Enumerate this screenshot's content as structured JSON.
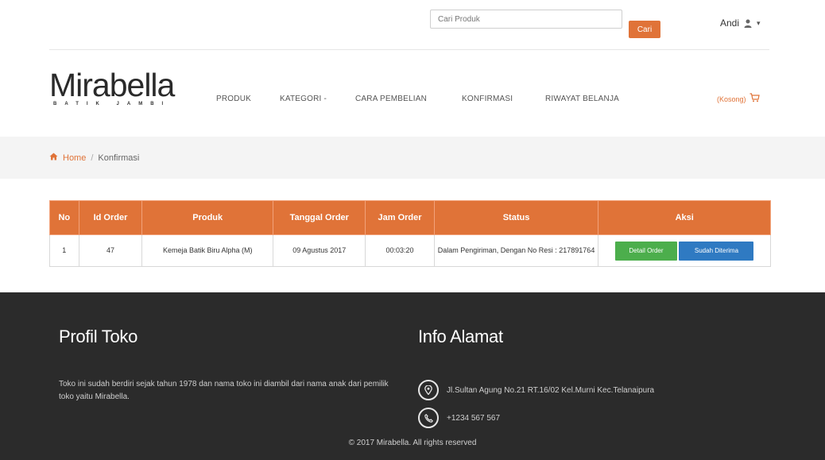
{
  "topbar": {
    "search_placeholder": "Cari Produk",
    "search_button": "Cari",
    "user_name": "Andi",
    "user_icon": "user-icon",
    "caret_icon": "caret-down-icon"
  },
  "header": {
    "logo_main": "Mirabella",
    "logo_sub": "BATIK JAMBI",
    "nav": [
      {
        "label": "PRODUK"
      },
      {
        "label": "KATEGORI -"
      },
      {
        "label": "CARA PEMBELIAN"
      },
      {
        "label": "KONFIRMASI"
      },
      {
        "label": "RIWAYAT BELANJA"
      }
    ],
    "cart_label": "(Kosong)",
    "cart_icon": "cart-icon"
  },
  "breadcrumb": {
    "home": "Home",
    "separator": "/",
    "current": "Konfirmasi"
  },
  "table": {
    "headers": [
      "No",
      "Id Order",
      "Produk",
      "Tanggal Order",
      "Jam Order",
      "Status",
      "Aksi"
    ],
    "rows": [
      {
        "no": "1",
        "id_order": "47",
        "produk": "Kemeja Batik Biru Alpha (M)",
        "tanggal": "09 Agustus 2017",
        "jam": "00:03:20",
        "status": "Dalam Pengiriman, Dengan No Resi : 217891764",
        "action_detail": "Detail Order",
        "action_received": "Sudah Diterima"
      }
    ]
  },
  "footer": {
    "left_title": "Profil Toko",
    "left_text": "Toko ini sudah berdiri sejak tahun 1978 dan nama toko ini diambil dari nama anak dari pemilik toko yaitu Mirabella.",
    "right_title": "Info Alamat",
    "address": "Jl.Sultan Agung No.21 RT.16/02 Kel.Murni Kec.Telanaipura",
    "phone": "+1234 567 567",
    "copyright": "© 2017 Mirabella. All rights reserved"
  },
  "colors": {
    "accent": "#e07338",
    "footer_bg": "#2b2b2b",
    "success": "#4cae4c",
    "primary": "#2f7ac2"
  }
}
